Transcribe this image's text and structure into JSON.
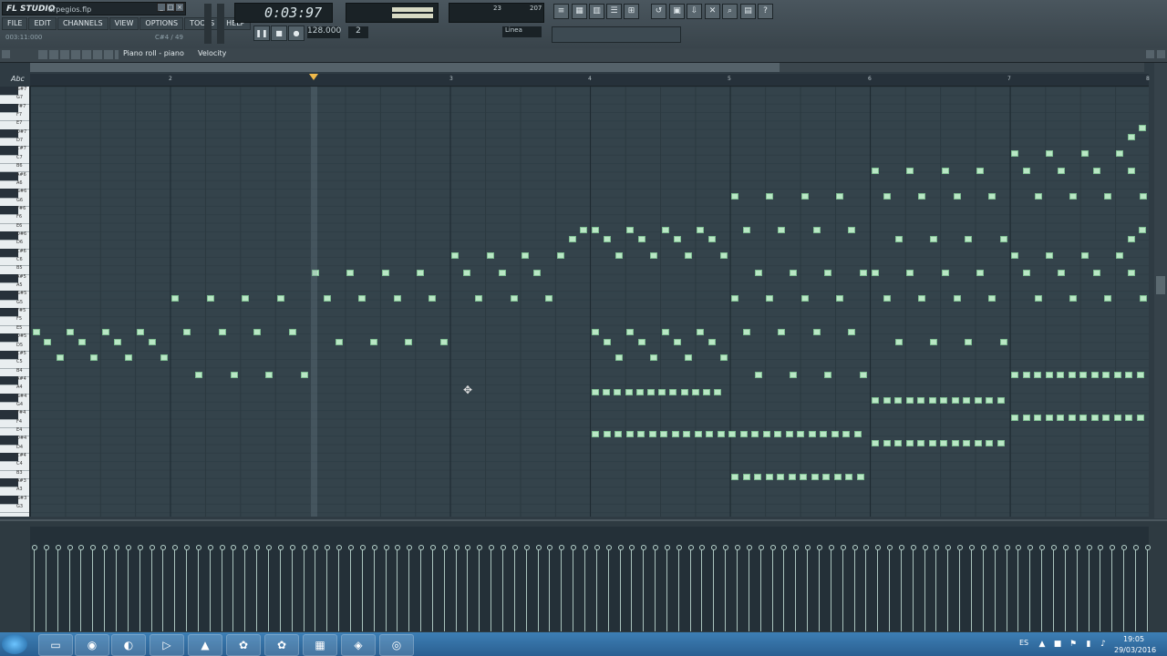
{
  "app": {
    "logo": "FL STUDIO",
    "filename": "arpegios.flp"
  },
  "menu": [
    "FILE",
    "EDIT",
    "CHANNELS",
    "VIEW",
    "OPTIONS",
    "TOOLS",
    "HELP"
  ],
  "status": {
    "position": "003:11:000",
    "note": "C#4 / 49"
  },
  "transport": {
    "time": "0:03:97",
    "tempo": "128.000",
    "snap": "2",
    "line_mode": "Linea",
    "monitor_left": "23",
    "monitor_right": "207"
  },
  "piano_roll": {
    "title": "Piano roll - piano",
    "target": "Velocity",
    "keyboard_label": "Abc"
  },
  "ruler": {
    "bars": [
      "2",
      "3",
      "4",
      "5",
      "6",
      "7",
      "8"
    ]
  },
  "keyboard_notes": [
    "G#7",
    "G7",
    "F#7",
    "F7",
    "E7",
    "D#7",
    "D7",
    "C#7",
    "C7",
    "B6",
    "A#6",
    "A6",
    "G#6",
    "G6",
    "F#6",
    "F6",
    "E6",
    "D#6",
    "D6",
    "C#6",
    "C6",
    "B5",
    "A#5",
    "A5",
    "G#5",
    "G5",
    "F#5",
    "F5",
    "E5",
    "D#5",
    "D5",
    "C#5",
    "C5",
    "B4",
    "A#4",
    "A4",
    "G#4",
    "G4",
    "F#4",
    "F4",
    "E4",
    "D#4",
    "D4",
    "C#4",
    "C4",
    "B3",
    "A#3",
    "A3",
    "G#3",
    "G3"
  ],
  "taskbar": {
    "language": "ES",
    "time": "19:05",
    "date": "29/03/2016",
    "apps": [
      "explorer-icon",
      "chrome-icon",
      "ccleaner-icon",
      "media-player-icon",
      "vlc-icon",
      "fl-studio-icon",
      "fl-studio-alt-icon",
      "clapper-icon",
      "movie-maker-icon",
      "media-center-icon"
    ]
  },
  "colors": {
    "note": "#b9e7c5",
    "grid": "#34434b",
    "playhead": "#f0b94a",
    "taskbar": "#2a5f91"
  }
}
